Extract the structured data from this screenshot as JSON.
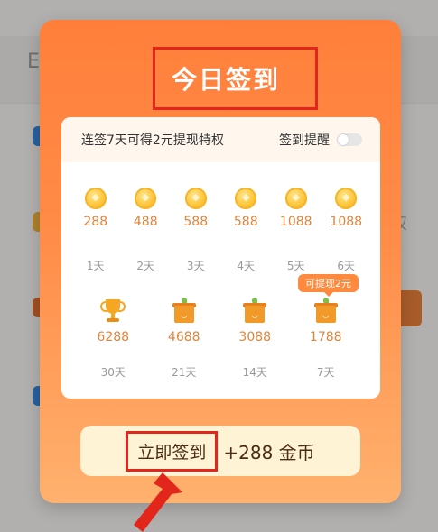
{
  "background": {
    "title_char": "E",
    "side_char": "权"
  },
  "modal": {
    "title": "今日签到",
    "rule_text": "连签7天可得2元提现特权",
    "remind_label": "签到提醒",
    "remind_on": false,
    "week1": [
      {
        "amount": "288",
        "day": "1天"
      },
      {
        "amount": "488",
        "day": "2天"
      },
      {
        "amount": "588",
        "day": "3天"
      },
      {
        "amount": "588",
        "day": "4天"
      },
      {
        "amount": "1088",
        "day": "5天"
      },
      {
        "amount": "1088",
        "day": "6天"
      }
    ],
    "milestones": [
      {
        "amount": "6288",
        "day": "30天",
        "icon": "trophy-icon"
      },
      {
        "amount": "4688",
        "day": "21天",
        "icon": "gift-icon"
      },
      {
        "amount": "3088",
        "day": "14天",
        "icon": "gift-icon"
      },
      {
        "amount": "1788",
        "day": "7天",
        "icon": "gift-icon"
      }
    ],
    "badge": "可提现2元",
    "button_label": "立即签到",
    "button_reward": "+288 金币"
  },
  "colors": {
    "accent": "#ff7f3a",
    "annotation": "#e3261c",
    "amount": "#e0843b"
  }
}
